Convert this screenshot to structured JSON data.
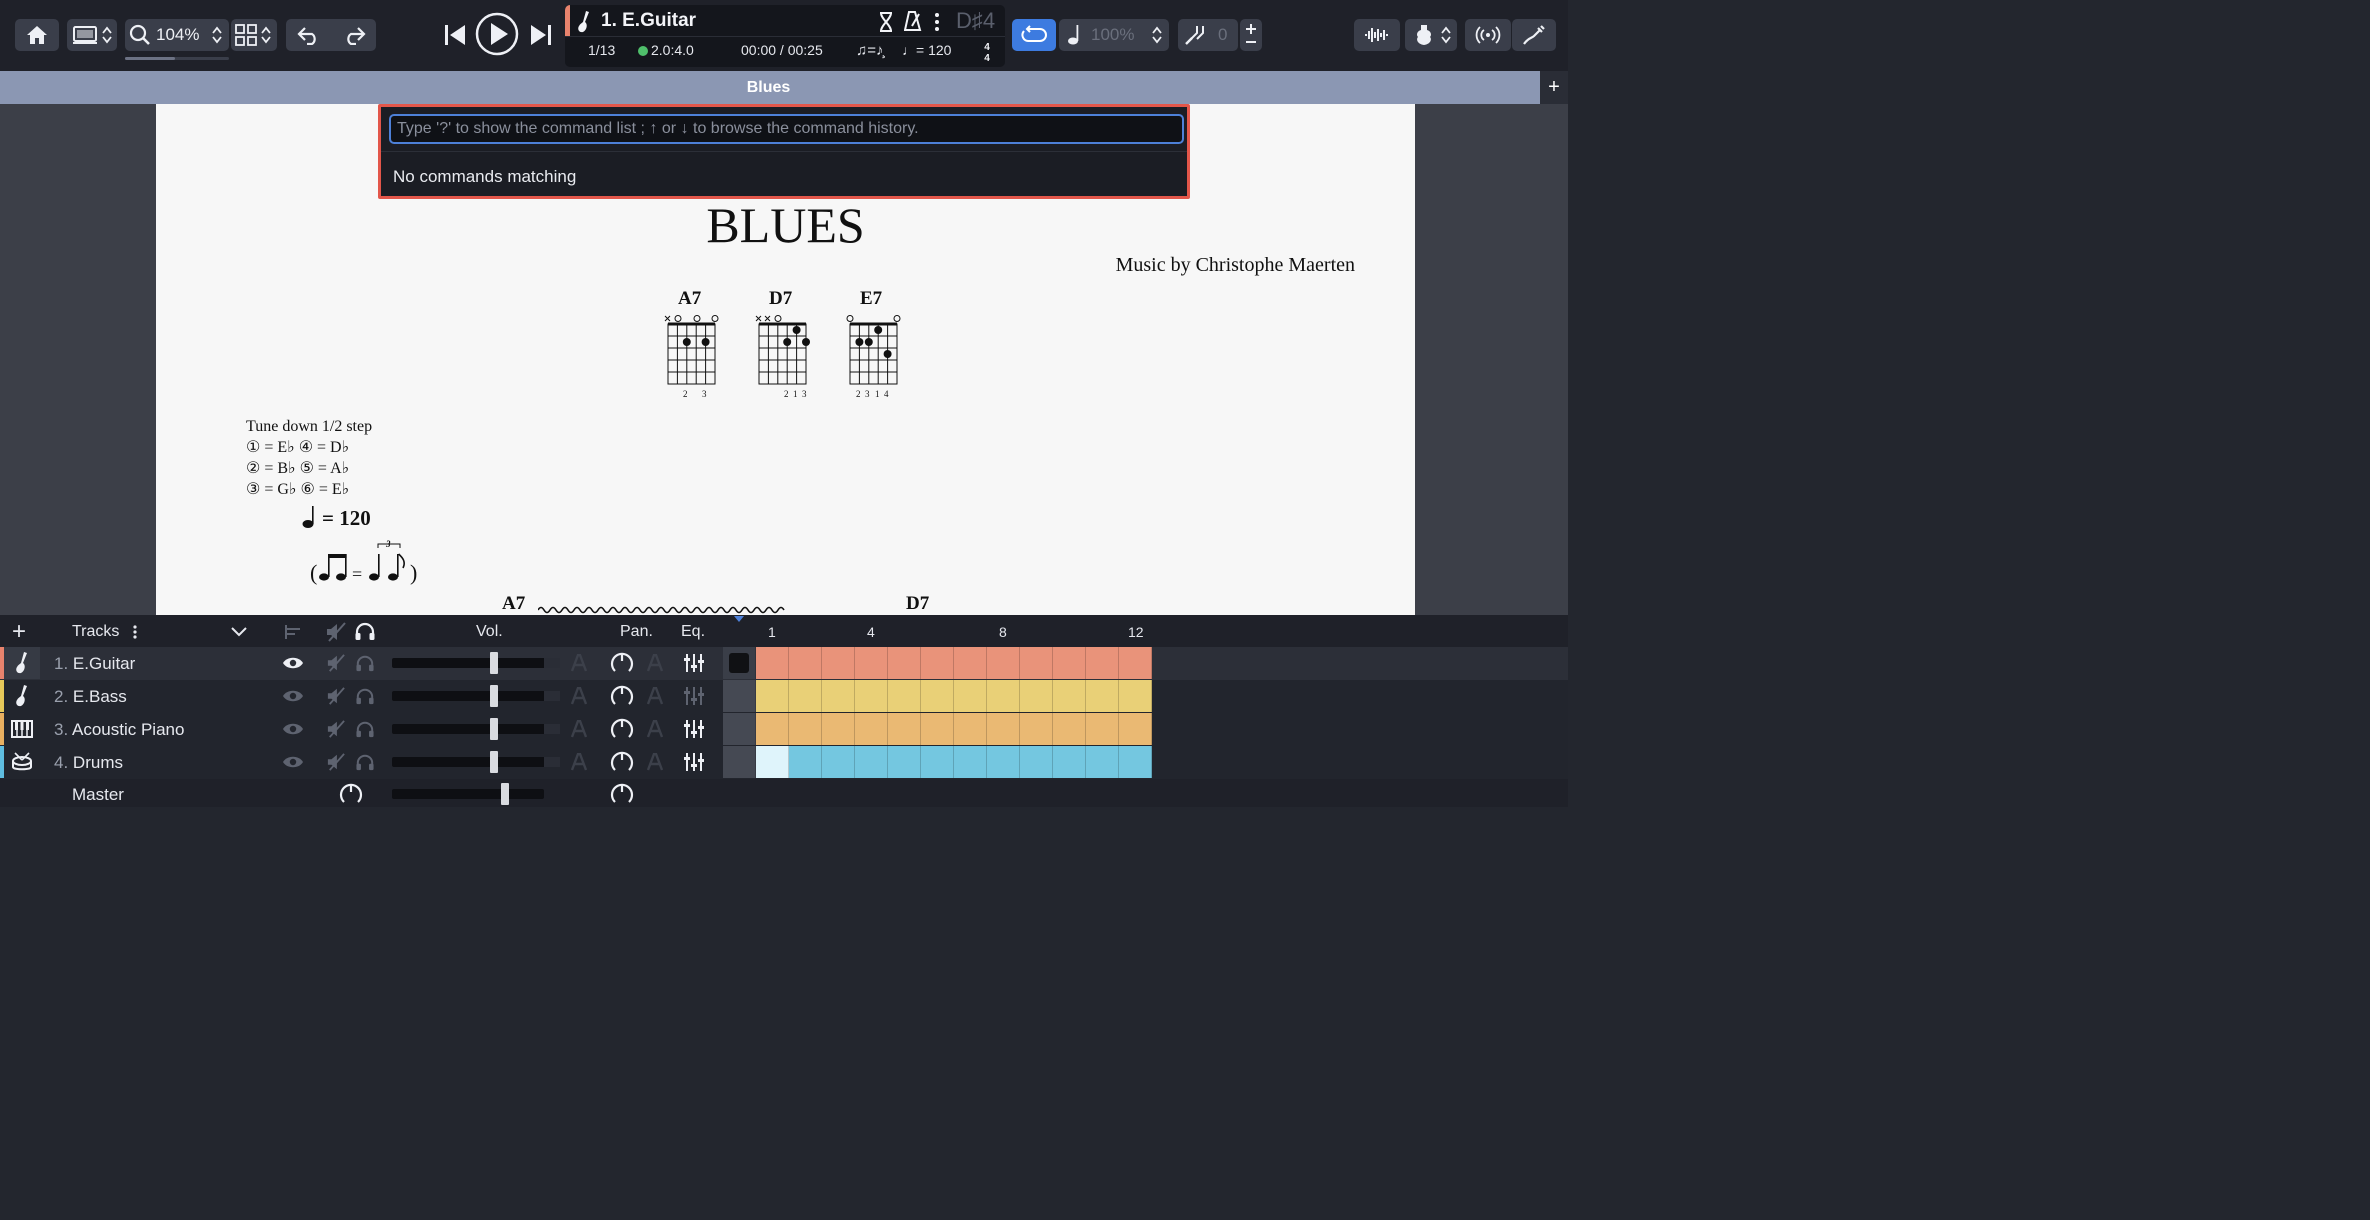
{
  "toolbar": {
    "zoom_label": "104%",
    "track_position": "1/13",
    "version": "2.0:4.0",
    "time": "00:00 / 00:25",
    "tempo": "♩= 120",
    "key": "D♯4",
    "speed_label": "100%",
    "pitch_label": "0",
    "track_name": "1. E.Guitar",
    "swing_label": "♫=♪̧"
  },
  "tab": {
    "title": "Blues",
    "add_label": "+"
  },
  "command_palette": {
    "placeholder": "Type '?' to show the command list ; ↑ or ↓ to browse the command history.",
    "empty_label": "No commands matching"
  },
  "score": {
    "title": "BLUES",
    "composer": "Music by Christophe Maerten",
    "chords": [
      {
        "name": "A7",
        "fingering": "2  3",
        "open": "×o  o  o"
      },
      {
        "name": "D7",
        "fingering": "2 1 3",
        "open": "××o"
      },
      {
        "name": "E7",
        "fingering": "2 3 1 4",
        "open": "o        o"
      }
    ],
    "tuning": {
      "header": "Tune down 1/2 step",
      "lines": [
        "① = E♭   ④ = D♭",
        "② = B♭   ⑤ = A♭",
        "③ = G♭   ⑥ = E♭"
      ]
    },
    "tempo": "= 120",
    "swing_triplet": "3",
    "section_chords": [
      "A7",
      "D7"
    ]
  },
  "tracks_panel": {
    "header": {
      "add_label": "+",
      "tracks_label": "Tracks",
      "vol_label": "Vol.",
      "pan_label": "Pan.",
      "eq_label": "Eq.",
      "bar_numbers": [
        "1",
        "4",
        "8",
        "12"
      ]
    },
    "tracks": [
      {
        "num": "1.",
        "name": "E.Guitar",
        "color": "#e9937a",
        "stripe": "#e8836d",
        "icon": "electric-guitar-icon"
      },
      {
        "num": "2.",
        "name": "E.Bass",
        "color": "#e9d077",
        "stripe": "#e6c95a",
        "icon": "bass-guitar-icon"
      },
      {
        "num": "3.",
        "name": "Acoustic Piano",
        "color": "#eab973",
        "stripe": "#e9b060",
        "icon": "piano-icon"
      },
      {
        "num": "4.",
        "name": "Drums",
        "color": "#74c7e0",
        "stripe": "#5fbde0",
        "icon": "drum-icon"
      }
    ],
    "master_label": "Master"
  },
  "colors": {
    "accent_blue": "#3d7be0",
    "command_border": "#e3564a",
    "tab_bar": "#8b97b3"
  }
}
